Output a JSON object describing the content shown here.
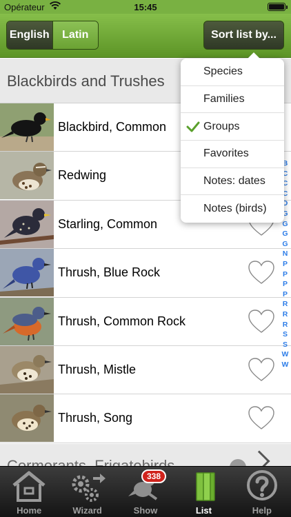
{
  "status_bar": {
    "carrier": "Opérateur",
    "time": "15:45"
  },
  "nav": {
    "lang_options": [
      "English",
      "Latin"
    ],
    "lang_selected": "English",
    "sort_button": "Sort list by..."
  },
  "section": {
    "title": "Blackbirds and Trushes"
  },
  "birds": [
    {
      "name": "Blackbird, Common"
    },
    {
      "name": "Redwing"
    },
    {
      "name": "Starling, Common"
    },
    {
      "name": "Thrush, Blue Rock"
    },
    {
      "name": "Thrush, Common Rock"
    },
    {
      "name": "Thrush, Mistle"
    },
    {
      "name": "Thrush, Song"
    }
  ],
  "next_section": {
    "title": "Cormorants, Frigatebirds"
  },
  "alphabet_index": [
    "B",
    "C",
    "C",
    "C",
    "D",
    "G",
    "G",
    "G",
    "G",
    "N",
    "P",
    "P",
    "P",
    "P",
    "R",
    "R",
    "R",
    "S",
    "S",
    "W",
    "W"
  ],
  "sort_menu": {
    "items": [
      "Species",
      "Families",
      "Groups",
      "Favorites",
      "Notes: dates",
      "Notes (birds)"
    ],
    "selected": "Groups"
  },
  "tabs": [
    {
      "label": "Home",
      "icon": "house-icon"
    },
    {
      "label": "Wizard",
      "icon": "gears-icon"
    },
    {
      "label": "Show",
      "icon": "bird-icon",
      "badge": "338"
    },
    {
      "label": "List",
      "icon": "books-icon",
      "active": true
    },
    {
      "label": "Help",
      "icon": "question-icon"
    }
  ],
  "colors": {
    "nav_green": "#79b142",
    "accent_blue": "#2d7de8",
    "check_green": "#5aa02c",
    "badge_red": "#d0231c"
  }
}
